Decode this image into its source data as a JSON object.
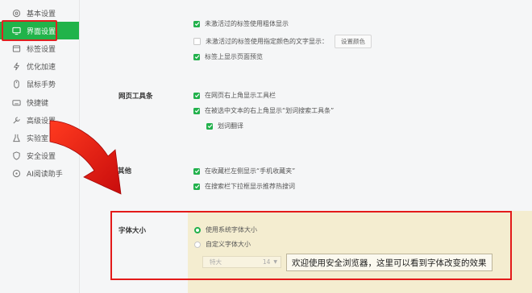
{
  "sidebar": {
    "items": [
      {
        "label": "基本设置",
        "icon": "gear-icon"
      },
      {
        "label": "界面设置",
        "icon": "monitor-icon",
        "active": true
      },
      {
        "label": "标签设置",
        "icon": "tab-icon"
      },
      {
        "label": "优化加速",
        "icon": "lightning-icon"
      },
      {
        "label": "鼠标手势",
        "icon": "mouse-icon"
      },
      {
        "label": "快捷键",
        "icon": "keyboard-icon"
      },
      {
        "label": "高级设置",
        "icon": "wrench-icon"
      },
      {
        "label": "实验室",
        "icon": "flask-icon"
      },
      {
        "label": "安全设置",
        "icon": "shield-icon"
      },
      {
        "label": "AI阅读助手",
        "icon": "ai-icon"
      }
    ]
  },
  "tabs_section": {
    "options": [
      {
        "label": "未激活过的标签使用粗体显示",
        "checked": true
      },
      {
        "label": "未激活过的标签使用指定颜色的文字显示：",
        "checked": false,
        "button": "设置颜色"
      },
      {
        "label": "标签上显示页面预览",
        "checked": true
      }
    ]
  },
  "toolbar_section": {
    "title": "网页工具条",
    "options": [
      {
        "label": "在网页右上角显示工具栏",
        "checked": true
      },
      {
        "label": "在被选中文本的右上角显示“划词搜索工具条”",
        "checked": true
      },
      {
        "label": "划词翻译",
        "checked": true
      }
    ]
  },
  "other_section": {
    "title": "其他",
    "options": [
      {
        "label": "在收藏栏左侧显示“手机收藏夹”",
        "checked": true
      },
      {
        "label": "在搜索栏下拉框显示推荐热搜词",
        "checked": true
      }
    ]
  },
  "font_section": {
    "title": "字体大小",
    "options": [
      {
        "label": "使用系统字体大小",
        "selected": true
      },
      {
        "label": "自定义字体大小",
        "selected": false
      }
    ],
    "select_value": "特大",
    "size_value": "14",
    "preview_text": "欢迎使用安全浏览器，这里可以看到字体改变的效果"
  },
  "colors": {
    "accent": "#21b34a",
    "annotation_red": "#e31a1a",
    "panel_bg": "#f4edd0"
  }
}
